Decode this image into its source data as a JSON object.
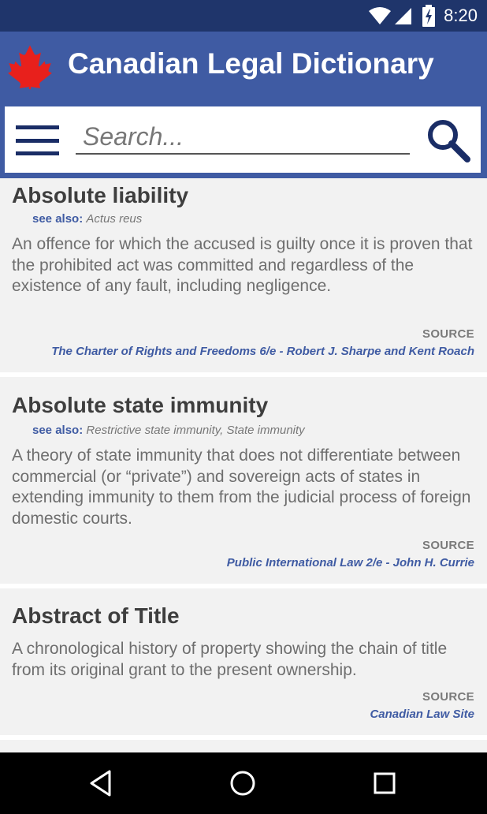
{
  "status_bar": {
    "time": "8:20",
    "icons": [
      "wifi-icon",
      "cell-signal-icon",
      "battery-charging-icon"
    ]
  },
  "app_bar": {
    "title": "Canadian Legal Dictionary",
    "logo": "maple-leaf-icon",
    "brand_color": "#3f5ba3",
    "status_color": "#1f356b",
    "logo_color": "#e8201c"
  },
  "search": {
    "placeholder": "Search...",
    "value": ""
  },
  "entries": [
    {
      "term": "Absolute liability",
      "see_also_label": "see also:",
      "see_also": "Actus reus",
      "definition": "An offence for which the accused is guilty once it is proven that the prohibited act was committed and regardless of the existence of any fault, including negligence.",
      "source_label": "SOURCE",
      "source": "The Charter of Rights and Freedoms 6/e - Robert J. Sharpe and Kent Roach"
    },
    {
      "term": "Absolute state immunity",
      "see_also_label": "see also:",
      "see_also": "Restrictive state immunity,  State immunity",
      "definition": "A theory of state immunity that does not differentiate between commercial (or “private”) and sovereign acts of states in extending immunity to them from the judicial process of foreign domestic courts.",
      "source_label": "SOURCE",
      "source": "Public International Law 2/e - John H. Currie"
    },
    {
      "term": "Abstract of Title",
      "definition": "A chronological history of property showing the chain of title from its original grant to the present ownership.",
      "source_label": "SOURCE",
      "source": "Canadian Law Site"
    }
  ],
  "nav_bar": {
    "buttons": [
      "back-icon",
      "home-icon",
      "recents-icon"
    ]
  }
}
